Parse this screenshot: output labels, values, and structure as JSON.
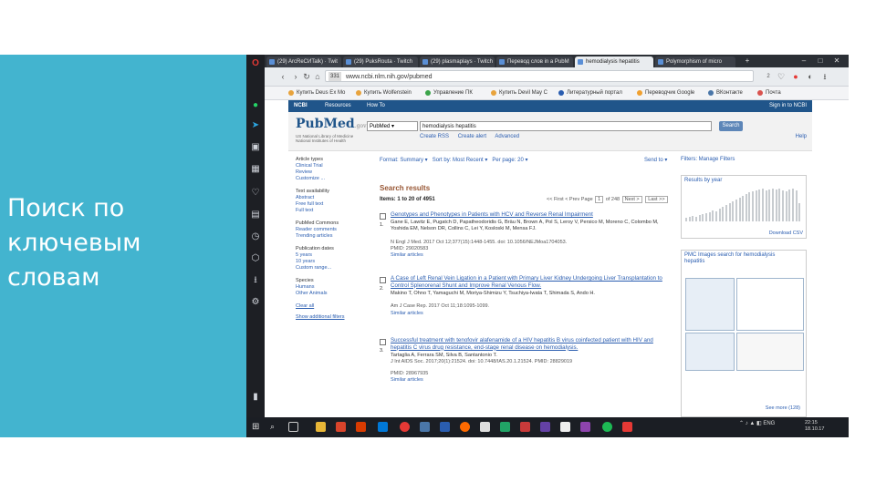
{
  "slide": {
    "title": "Поиск по\nключевым\nсловам"
  },
  "colors": {
    "slide_panel": "#43b4cf",
    "ncbi_blue": "#20558a",
    "link": "#2a5db0"
  },
  "browser": {
    "tabs": [
      {
        "label": "(29) ArcReСИTalk) · Twit",
        "active": false
      },
      {
        "label": "(29) PuksRouta · Twitch",
        "active": false
      },
      {
        "label": "(29) plasmaplays · Twitch",
        "active": false
      },
      {
        "label": "Перевод слов in a PubM",
        "active": false
      },
      {
        "label": "hemodialysis hepatitis",
        "active": true
      },
      {
        "label": "Polymorphism of micro",
        "active": false
      }
    ],
    "address": {
      "badge": "331",
      "url": "www.ncbi.nlm.nih.gov/pubmed"
    },
    "address_badge_right": "2",
    "bookmarks": [
      "Купить Deus Ex Mo",
      "Купить Wolfenstein",
      "Управление ПК",
      "Купить Devil May C",
      "Литературный портал",
      "Переводчик Google",
      "ВКонтакте",
      "Почта"
    ]
  },
  "pubmed": {
    "ncbi_bar": {
      "logo": "NCBI",
      "resources": "Resources",
      "howto": "How To",
      "signin": "Sign in to NCBI"
    },
    "logo": "PubMed",
    "logo_suffix": ".gov",
    "logo_sub": "US National Library of Medicine National Institutes of Health",
    "db_select": "PubMed",
    "search_term": "hemodialysis hepatitis",
    "search_button": "Search",
    "links": [
      "Create RSS",
      "Create alert",
      "Advanced"
    ],
    "help": "Help",
    "left_filters": [
      {
        "head": "Article types",
        "items": [
          "Clinical Trial",
          "Review",
          "Customize ..."
        ]
      },
      {
        "head": "Text availability",
        "items": [
          "Abstract",
          "Free full text",
          "Full text"
        ]
      },
      {
        "head": "PubMed Commons",
        "items": [
          "Reader comments",
          "Trending articles"
        ]
      },
      {
        "head": "Publication dates",
        "items": [
          "5 years",
          "10 years",
          "Custom range..."
        ]
      },
      {
        "head": "Species",
        "items": [
          "Humans",
          "Other Animals"
        ]
      },
      {
        "head": "",
        "items": [
          "Clear all",
          "Show additional filters"
        ]
      }
    ],
    "toolbar": {
      "format": "Format: Summary ▾",
      "sort": "Sort by: Most Recent ▾",
      "per_page": "Per page: 20 ▾",
      "send_to": "Send to ▾"
    },
    "results_title": "Search results",
    "items_text": "Items: 1 to 20 of 4951",
    "pager": {
      "first": "<< First",
      "prev": "< Prev",
      "page_label": "Page",
      "page": "1",
      "of": "of 248",
      "next": "Next >",
      "last": "Last >>"
    },
    "results": [
      {
        "n": "1.",
        "title": "Genotypes and Phenotypes in Patients with HCV and Reverse Renal Impairment",
        "authors": "Gane E, Lawitz E, Pugatch D, Papatheodoridis G, Bräu N, Brown A, Pol S, Leroy V, Persico M, Moreno C, Colombo M, Yoshida EM, Nelson DR, Collins C, Lei Y, Kosloski M, Mensa FJ.",
        "journal": "N Engl J Med. 2017 Oct 12;377(15):1448-1455. doi: 10.1056/NEJMoa1704053.",
        "pmid": "PMID: 29020583",
        "similar": "Similar articles"
      },
      {
        "n": "2.",
        "title": "A Case of Left Renal Vein Ligation in a Patient with Primary Liver Kidney Undergoing Liver Transplantation to Control Splenorenal Shunt and Improve Renal Venous Flow.",
        "authors": "Makino T, Ohno T, Yamaguchi M, Moriya-Shimizu Y, Tsuchiya-Iwata T, Shimada S, Ando H.",
        "journal": "Am J Case Rep. 2017 Oct 11;18:1095-1099.",
        "pmid": "",
        "similar": "Similar articles"
      },
      {
        "n": "3.",
        "title": "Successful treatment with tenofovir alafenamide of a HIV hepatitis B virus coinfected patient with HIV and hepatitis C virus drug resistance, end-stage renal disease on hemodialysis.",
        "authors": "Tartaglia A, Ferrara SM, Silva B, Santantonio T.",
        "journal": "J Int AIDS Soc. 2017;20(1):21524. doi: 10.7448/IAS.20.1.21524. PMID: 28829019",
        "pmid": "PMID: 28967935",
        "similar": "Similar articles"
      }
    ],
    "right": {
      "filters_manager": "Filters: Manage Filters",
      "year_title": "Results by year",
      "download": "Download CSV",
      "pmc_title": "PMC Images search for hemodialysis hepatitis",
      "see_more": "See more (128)"
    }
  },
  "taskbar": {
    "lang": "ENG",
    "time": "22:15",
    "date": "18.10.17"
  }
}
